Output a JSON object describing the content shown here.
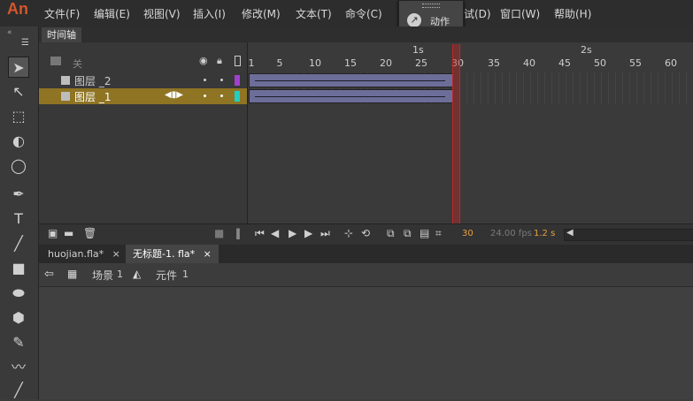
{
  "app": {
    "logo": "An"
  },
  "menu": {
    "items": [
      "文件(F)",
      "编辑(E)",
      "视图(V)",
      "插入(I)",
      "修改(M)",
      "文本(T)",
      "命令(C)",
      "试(D)",
      "窗口(W)",
      "帮助(H)"
    ]
  },
  "popup": {
    "label": "动作"
  },
  "timeline": {
    "tab": "时间轴",
    "scene_label": "关",
    "layers": [
      {
        "name": "图层 _2",
        "color": "#a040d0",
        "selected": false
      },
      {
        "name": "图层 _1",
        "color": "#20d0c0",
        "selected": true
      }
    ],
    "ruler": {
      "numbers": [
        "1",
        "5",
        "10",
        "15",
        "20",
        "25",
        "30",
        "35",
        "40",
        "45",
        "50",
        "55",
        "60"
      ],
      "seconds": [
        "1s",
        "2s"
      ]
    },
    "current_frame": "30",
    "fps": "24.00 fps",
    "time": "1.2 s"
  },
  "doc_tabs": [
    {
      "label": "huojian.fla*",
      "close": "×",
      "active": false
    },
    {
      "label": "无标题-1. fla*",
      "close": "×",
      "active": true
    }
  ],
  "edit_bar": {
    "scene": "场景",
    "scene_num": "1",
    "symbol": "元件",
    "symbol_num": "1"
  },
  "colors": {
    "selected_row": "#8f7423",
    "tween": "#6d6d99",
    "playhead": "#b82a2a",
    "accent_orange": "#e6a040"
  }
}
